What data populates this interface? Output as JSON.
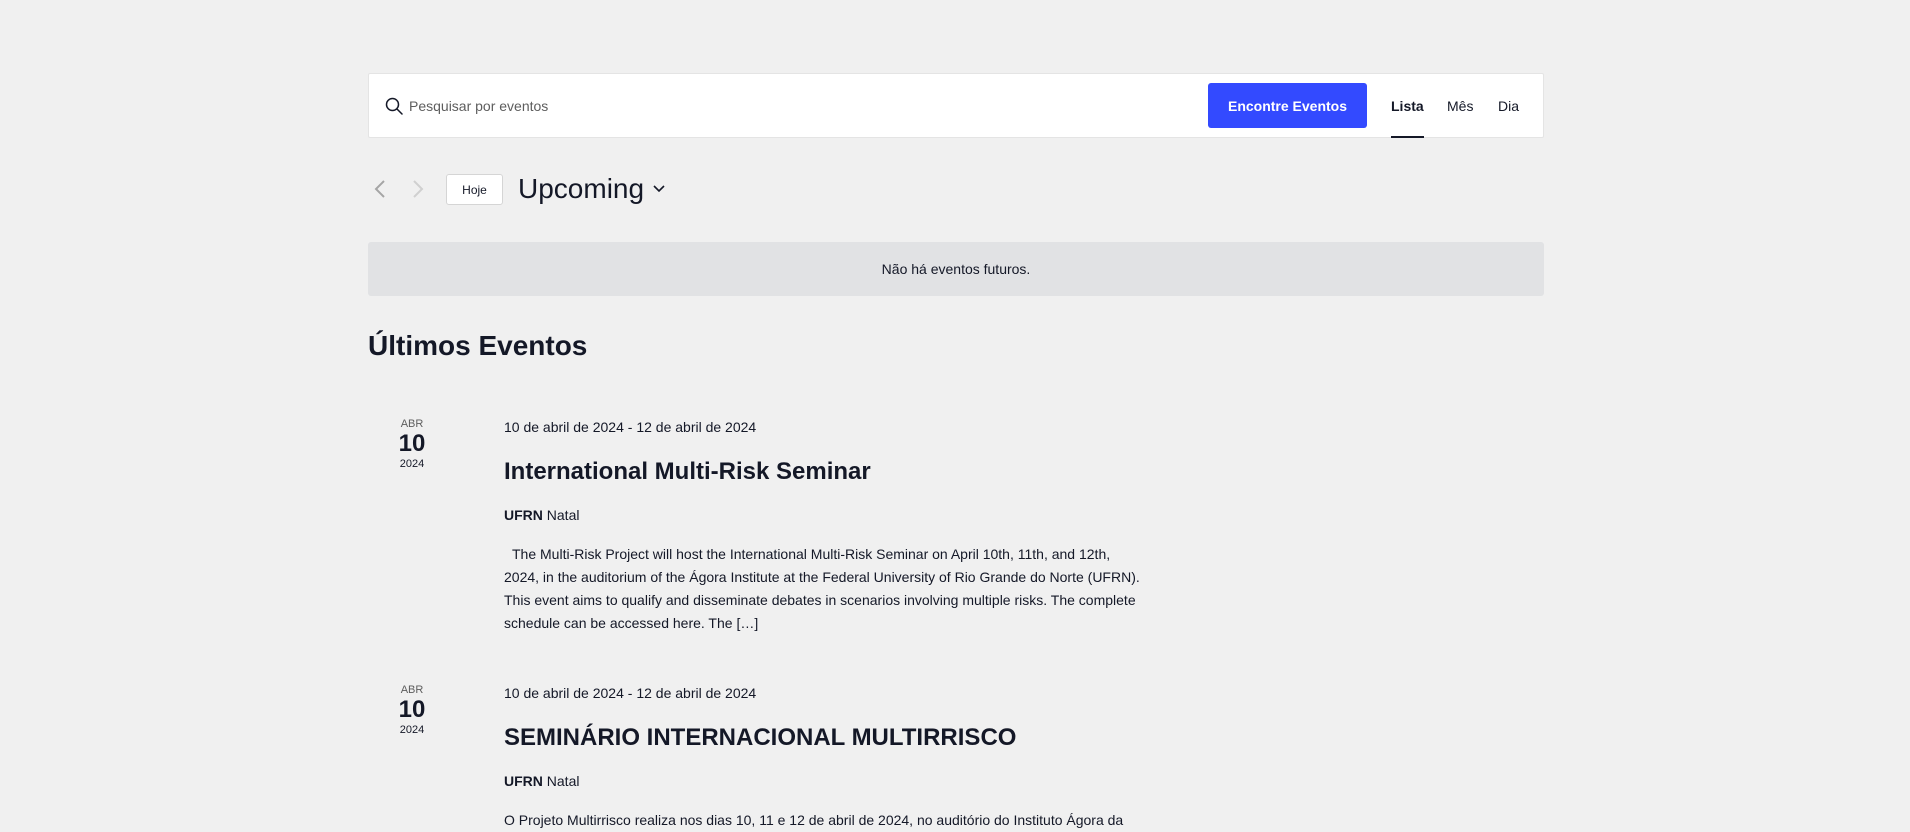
{
  "search": {
    "placeholder": "Pesquisar por eventos",
    "button_label": "Encontre Eventos"
  },
  "views": [
    {
      "label": "Lista",
      "active": true
    },
    {
      "label": "Mês",
      "active": false
    },
    {
      "label": "Dia",
      "active": false
    }
  ],
  "nav": {
    "today_label": "Hoje",
    "range_label": "Upcoming"
  },
  "notice": "Não há eventos futuros.",
  "section_title": "Últimos Eventos",
  "events": [
    {
      "month": "ABR",
      "day": "10",
      "year": "2024",
      "datetime": "10 de abril de 2024 - 12 de abril de 2024",
      "title": "International Multi-Risk Seminar",
      "venue_name": "UFRN",
      "venue_city": "Natal",
      "description": "The Multi-Risk Project will host the International Multi-Risk Seminar on April 10th, 11th, and 12th, 2024, in the auditorium of the Ágora Institute at the Federal University of Rio Grande do Norte (UFRN). This event aims to qualify and disseminate debates in scenarios involving multiple risks. The complete schedule can be accessed here. The […]"
    },
    {
      "month": "ABR",
      "day": "10",
      "year": "2024",
      "datetime": "10 de abril de 2024 - 12 de abril de 2024",
      "title": "SEMINÁRIO INTERNACIONAL MULTIRRISCO",
      "venue_name": "UFRN",
      "venue_city": "Natal",
      "description": "O Projeto Multirrisco realiza nos dias 10, 11 e 12 de abril de 2024, no auditório do Instituto Ágora da"
    }
  ],
  "colors": {
    "accent": "#334aff",
    "background": "#f0f0f0",
    "notice_bg": "#e1e2e4",
    "text": "#141827"
  }
}
